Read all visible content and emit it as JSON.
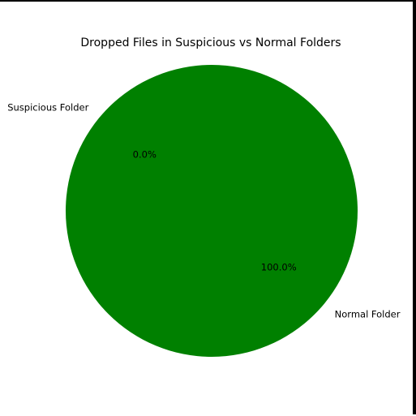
{
  "chart_data": {
    "type": "pie",
    "title": "Dropped Files in Suspicious vs Normal Folders",
    "categories": [
      "Suspicious Folder",
      "Normal Folder"
    ],
    "values": [
      0.0,
      100.0
    ],
    "percent_labels": [
      "0.0%",
      "100.0%"
    ],
    "colors": [
      "#1f77b4",
      "#008000"
    ],
    "start_angle_deg": 140
  }
}
